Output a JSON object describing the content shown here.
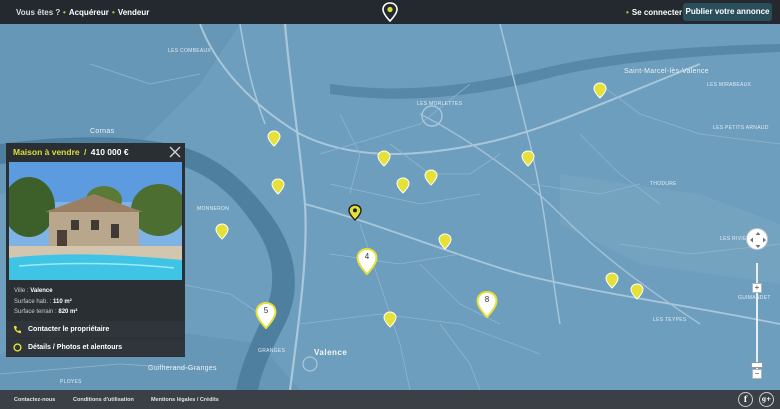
{
  "topbar": {
    "vous_etes": "Vous êtes ?",
    "nav_acquereur": "Acquéreur",
    "nav_vendeur": "Vendeur",
    "login": "Se connecter",
    "publish": "Publier votre annonce",
    "accent": "#b7c73a"
  },
  "map": {
    "places": {
      "valence": "Valence",
      "saint_marcel": "Saint-Marcel-lès-Valence",
      "cornas": "Cornas",
      "les_combeaux": "LES COMBEAUX",
      "les_morlettes": "LES MORLETTES",
      "les_mirabeaux": "LES MIRABEAUX",
      "les_petits_arnaud": "LES PETITS ARNAUD",
      "monneron": "MONNERON",
      "thodure": "THODURE",
      "les_riviers": "LES RIVIERS",
      "les_teypes": "LES TEYPES",
      "granges": "GRANGES",
      "guilherand": "Guilherand-Granges",
      "ployes": "PLOYES",
      "guimandet": "GUIMANDET"
    },
    "clusters": {
      "c1": "4",
      "c2": "5",
      "c3": "8"
    },
    "pin_color": "#e5e138"
  },
  "listing": {
    "type": "Maison à vendre",
    "separator": "/",
    "price": "410 000 €",
    "ville_label": "Ville :",
    "ville_value": "Valence",
    "surface_hab_label": "Surface hab. :",
    "surface_hab_value": "110 m²",
    "surface_terrain_label": "Surface terrain :",
    "surface_terrain_value": "820 m²",
    "contact_label": "Contacter le propriétaire",
    "details_label": "Détails / Photos et alentours"
  },
  "footer": {
    "contact": "Contactez-nous",
    "conditions": "Conditions d'utilisation",
    "mentions": "Mentions légales / Crédits",
    "facebook": "f",
    "google": "g+"
  }
}
